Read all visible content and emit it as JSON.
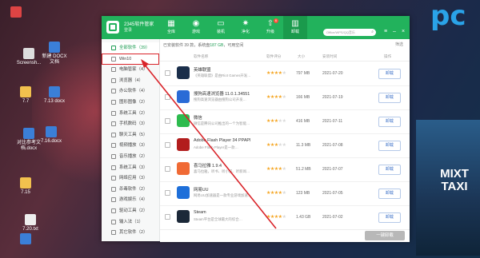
{
  "desktop": {
    "icons": [
      {
        "label": "",
        "color": "#d44"
      },
      {
        "label": "Screensh...",
        "color": "#ddd"
      },
      {
        "label": "新建 DOCX 文档",
        "color": "#3b7fd8"
      },
      {
        "label": "7.7",
        "color": "#f2c14e"
      },
      {
        "label": "7.13 docx",
        "color": "#3b7fd8"
      },
      {
        "label": "7.16.docx",
        "color": "#3b7fd8"
      },
      {
        "label": "对比参考文档.docx",
        "color": "#3b7fd8"
      },
      {
        "label": "7.15",
        "color": "#f2c14e"
      },
      {
        "label": "7.20.txt",
        "color": "#eee"
      },
      {
        "label": "",
        "color": "#3b7fd8"
      }
    ],
    "brand_text": "pc",
    "sign_text": "MIXT TAXI"
  },
  "window": {
    "brand_title": "2345软件管家",
    "brand_sub": "登录",
    "nav": [
      {
        "label": "全库",
        "icon": "grid-icon"
      },
      {
        "label": "游戏",
        "icon": "gamepad-icon"
      },
      {
        "label": "装机",
        "icon": "monitor-icon"
      },
      {
        "label": "净化",
        "icon": "shield-icon"
      },
      {
        "label": "升级",
        "icon": "upgrade-icon",
        "badge": "6"
      },
      {
        "label": "卸载",
        "icon": "trash-icon"
      }
    ],
    "active_nav": 5,
    "search_placeholder": "Office/WPS/QQ音乐",
    "win_buttons": [
      "≡",
      "–",
      "×"
    ]
  },
  "sidebar": {
    "items": [
      {
        "label": "全部软件（39）"
      },
      {
        "label": "Win10"
      },
      {
        "label": "电脑管家（4）"
      },
      {
        "label": "浏览器（4）"
      },
      {
        "label": "办公软件（4）"
      },
      {
        "label": "图形图像（2）"
      },
      {
        "label": "系统工具（2）"
      },
      {
        "label": "手机数码（3）"
      },
      {
        "label": "聊天工具（5）"
      },
      {
        "label": "视频播放（3）"
      },
      {
        "label": "音乐播放（2）"
      },
      {
        "label": "系统工具（3）"
      },
      {
        "label": "网络应用（3）"
      },
      {
        "label": "杀毒软件（2）"
      },
      {
        "label": "游戏娱乐（4）"
      },
      {
        "label": "驱动工具（2）"
      },
      {
        "label": "输入法（1）"
      },
      {
        "label": "其它软件（2）"
      }
    ],
    "active_index": 0,
    "highlight_index": 1
  },
  "main": {
    "summary_prefix": "已安装软件 39 款，系统盘",
    "summary_value": "187 GB",
    "summary_mid": "，可用空间",
    "filter_label": "筛选",
    "columns": [
      "软件名称",
      "软件评分",
      "大小",
      "安装时间",
      "操作"
    ],
    "apps": [
      {
        "name": "英雄联盟",
        "desc": "《英雄联盟》是由Riot Games开发…",
        "stars": 4,
        "size": "797 MB",
        "date": "2021-07-20",
        "color": "#1a2e4a",
        "action": "卸载"
      },
      {
        "name": "搜狗高速浏览器 11.0.1.34551",
        "desc": "搜狗高速浏览器由搜狗公司开发…",
        "stars": 4,
        "size": "166 MB",
        "date": "2021-07-19",
        "color": "#2a6bd6",
        "action": "卸载"
      },
      {
        "name": "微信",
        "desc": "微信是腾讯公司推出的一个为智能…",
        "stars": 3,
        "size": "416 MB",
        "date": "2021-07-11",
        "color": "#2dbb4e",
        "action": "卸载"
      },
      {
        "name": "Adobe Flash Player 34 PPAPI",
        "desc": "Adobe Flash Player是一款…",
        "stars": 3,
        "size": "11.3 MB",
        "date": "2021-07-08",
        "color": "#b21d1d",
        "action": "卸载"
      },
      {
        "name": "喜马拉雅 1.9.4",
        "desc": "喜马拉雅，听书、听小说、听新闻…",
        "stars": 4,
        "size": "51.2 MB",
        "date": "2021-07-07",
        "color": "#f06a35",
        "action": "卸载"
      },
      {
        "name": "网易UU",
        "desc": "网易UU加速器是一款专业游戏加速…",
        "stars": 4,
        "size": "123 MB",
        "date": "2021-07-05",
        "color": "#1e6fd9",
        "action": "卸载"
      },
      {
        "name": "Steam",
        "desc": "Steam平台是全球最大的综合…",
        "stars": 4,
        "size": "1.43 GB",
        "date": "2021-07-02",
        "color": "#1b2838",
        "action": "卸载"
      }
    ],
    "bulk_label": "一键卸载"
  }
}
